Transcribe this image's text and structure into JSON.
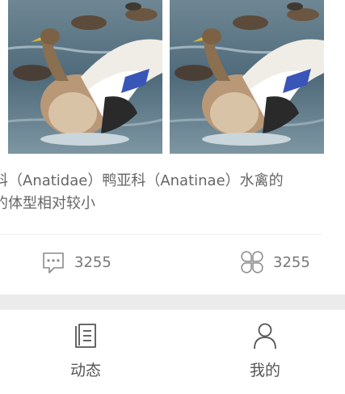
{
  "post": {
    "images": [
      {
        "name": "duck-photo-1",
        "subject": "mallard duck spreading wings on water"
      },
      {
        "name": "duck-photo-2",
        "subject": "mallard duck spreading wings on water"
      }
    ],
    "text": "科（Anatidae）鸭亚科（Anatinae）水禽的\n的体型相对较小",
    "comment_count": "3255",
    "like_count": "3255"
  },
  "tabbar": {
    "tabs": [
      {
        "label": "动态",
        "icon": "document-list-icon"
      },
      {
        "label": "我的",
        "icon": "user-profile-icon"
      }
    ]
  }
}
